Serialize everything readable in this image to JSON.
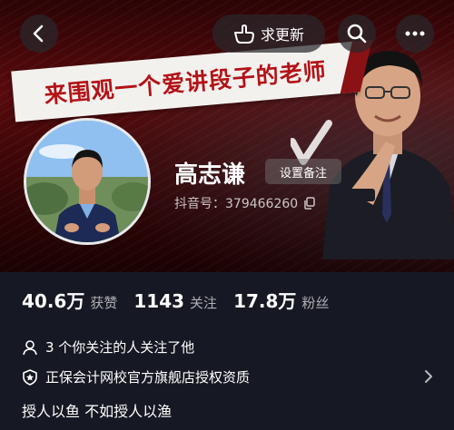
{
  "header": {
    "back_icon": "chevron-left-icon",
    "refresh_label": "求更新",
    "refresh_icon": "hand-point-icon",
    "search_icon": "search-icon",
    "more_icon": "more-dots-icon"
  },
  "banner": {
    "slogan": "来围观一个爱讲段子的老师",
    "accent": "#b31217"
  },
  "profile": {
    "name": "高志谦",
    "remark_label": "设置备注",
    "douyin_label": "抖音号：",
    "douyin_id": "379466260",
    "copy_icon": "copy-icon"
  },
  "stats": [
    {
      "value": "40.6万",
      "label": "获赞"
    },
    {
      "value": "1143",
      "label": "关注"
    },
    {
      "value": "17.8万",
      "label": "粉丝"
    }
  ],
  "info": {
    "mutual_follow": "3 个你关注的人关注了他",
    "certification": "正保会计网校官方旗舰店授权资质",
    "bio": "授人以鱼 不如授人以渔"
  }
}
